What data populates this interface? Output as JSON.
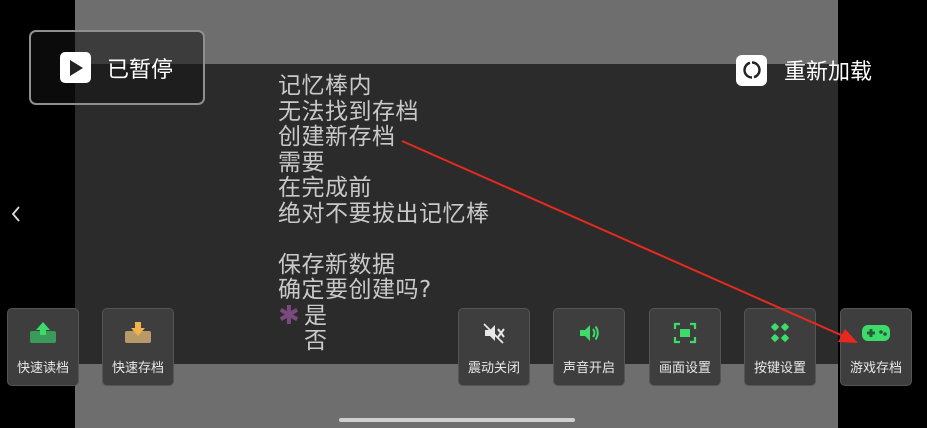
{
  "game_text": {
    "lines1": [
      "记忆棒内",
      "无法找到存档",
      "创建新存档",
      "需要",
      "在完成前",
      "绝对不要拔出记忆棒"
    ],
    "lines2": [
      "保存新数据",
      "确定要创建吗?"
    ],
    "option_yes": "是",
    "option_no": "否"
  },
  "pause_button": {
    "label": "已暂停",
    "icon": "play-icon"
  },
  "reload_button": {
    "label": "重新加载",
    "icon": "reload-icon"
  },
  "controls": {
    "quick_load": "快速读档",
    "quick_save": "快速存档",
    "vibration": "震动关闭",
    "sound": "声音开启",
    "screen": "画面设置",
    "keys": "按键设置",
    "game_save": "游戏存档"
  },
  "colors": {
    "accent_green": "#3ddc6a",
    "accent_orange": "#f0b24a",
    "annotation_arrow": "#e8291f",
    "selector_star": "#7a4a7e"
  }
}
